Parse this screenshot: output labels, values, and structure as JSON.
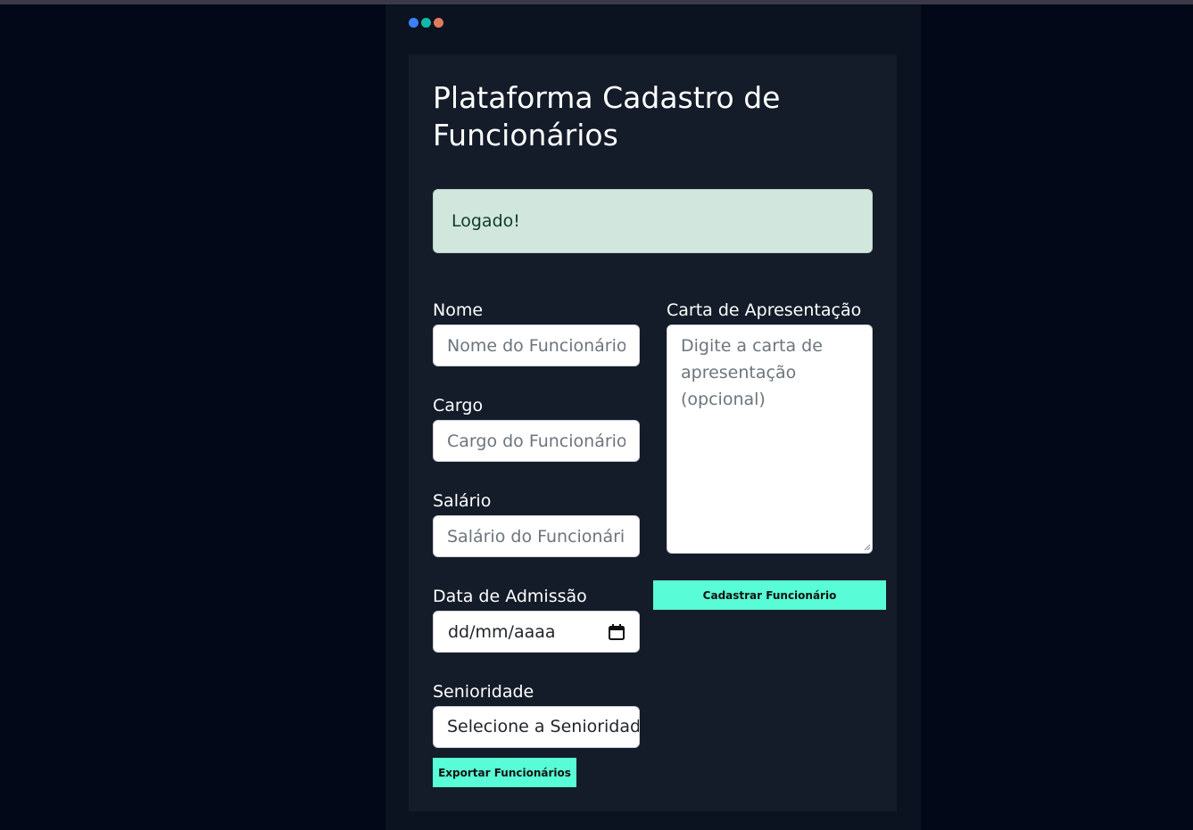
{
  "colors": {
    "dot_blue": "#3b82f6",
    "dot_teal": "#14b8a6",
    "dot_orange": "#e07a5f",
    "accent": "#58fcd6",
    "alert_bg": "#d1e7dd"
  },
  "page": {
    "title": "Plataforma Cadastro de Funcionários"
  },
  "alert": {
    "message": "Logado!"
  },
  "form": {
    "nome": {
      "label": "Nome",
      "placeholder": "Nome do Funcionário",
      "value": ""
    },
    "cargo": {
      "label": "Cargo",
      "placeholder": "Cargo do Funcionário",
      "value": ""
    },
    "salario": {
      "label": "Salário",
      "placeholder": "Salário do Funcionário",
      "value": ""
    },
    "admissao": {
      "label": "Data de Admissão",
      "placeholder": "dd/mm/aaaa",
      "icon": "calendar-icon"
    },
    "senioridade": {
      "label": "Senioridade",
      "selected": "Selecione a Senioridade"
    },
    "carta": {
      "label": "Carta de Apresentação",
      "placeholder": "Digite a carta de apresentação (opcional)"
    }
  },
  "buttons": {
    "cadastrar": "Cadastrar Funcionário",
    "exportar": "Exportar Funcionários"
  }
}
